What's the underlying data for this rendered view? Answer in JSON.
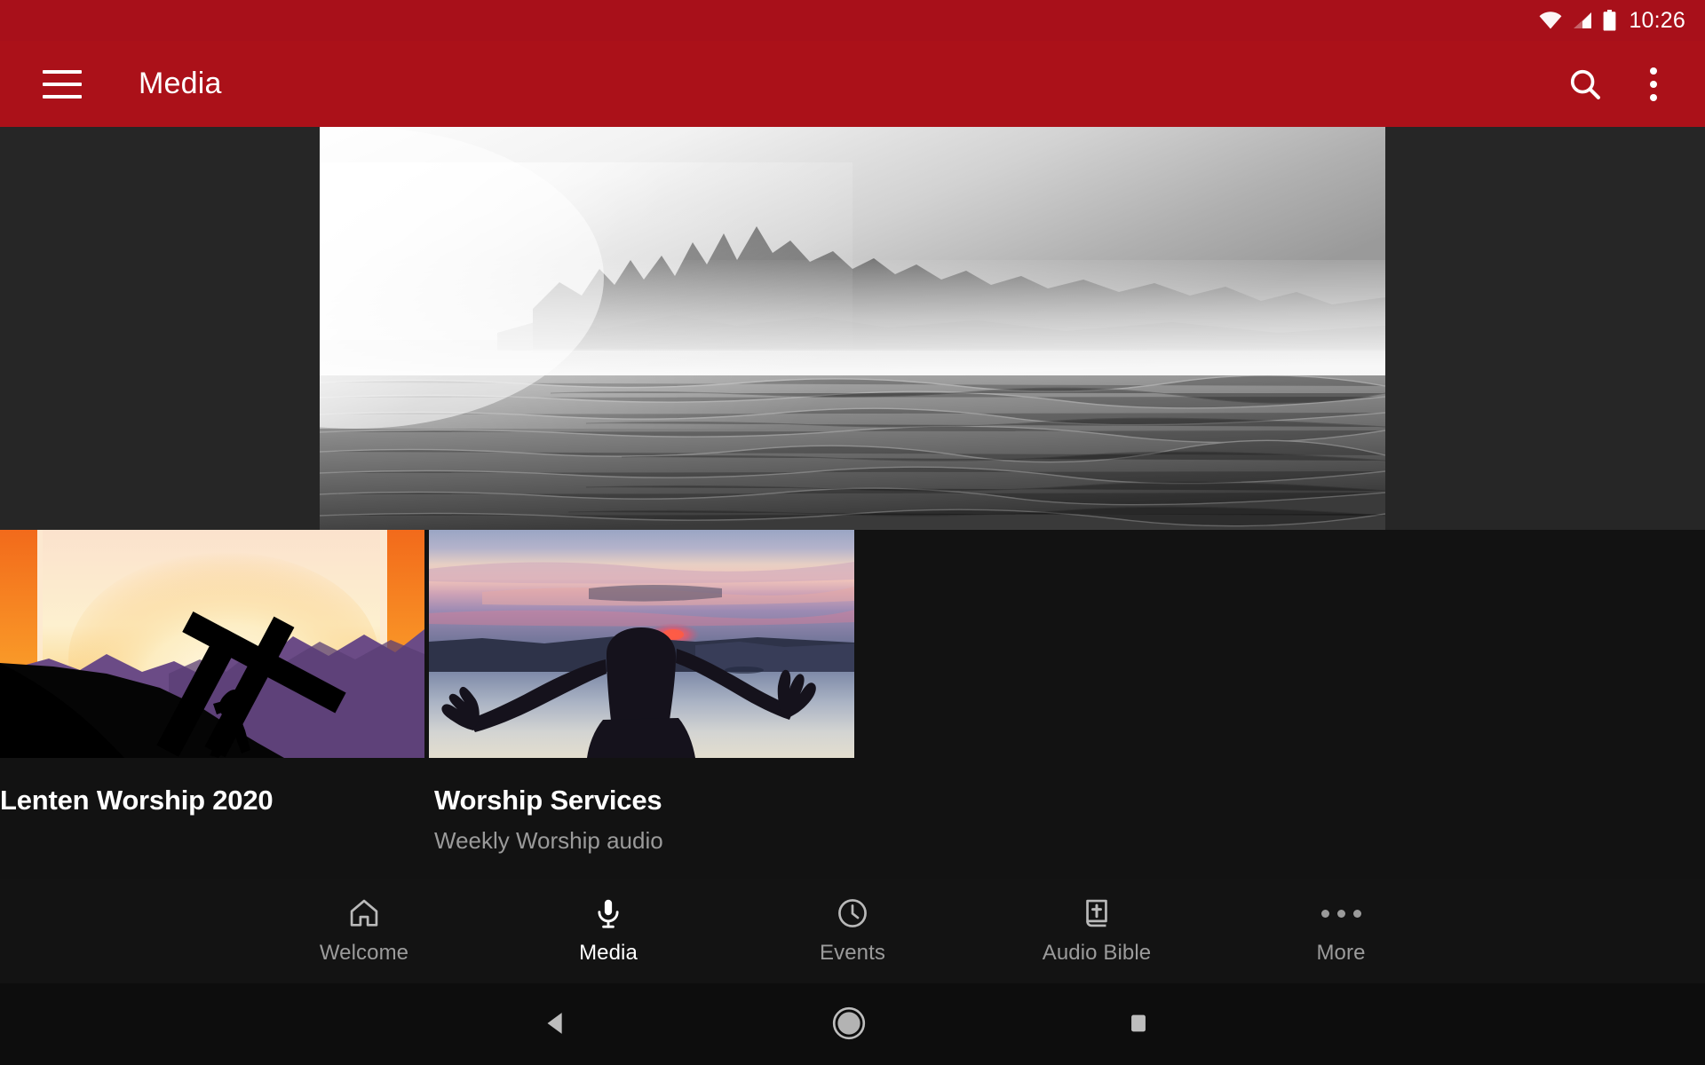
{
  "status_bar": {
    "time": "10:26",
    "icons": [
      "wifi-icon",
      "cellular-signal-icon",
      "battery-icon"
    ],
    "background_color": "#A8101A"
  },
  "app_bar": {
    "title": "Media",
    "menu_icon": "hamburger-menu-icon",
    "search_icon": "search-icon",
    "overflow_icon": "overflow-menu-icon",
    "background_color": "#AB1119",
    "text_color": "#FFFFFF"
  },
  "hero": {
    "alt": "Black and white misty mountains over a lake",
    "background_color": "#262626"
  },
  "media_cards": [
    {
      "title": "Lenten Worship 2020",
      "subtitle": "",
      "thumbnail": "silhouette-carrying-cross-at-sunset"
    },
    {
      "title": "Worship Services",
      "subtitle": "Weekly Worship audio",
      "thumbnail": "person-arms-raised-at-sunset-over-water"
    }
  ],
  "bottom_nav": {
    "active_index": 1,
    "items": [
      {
        "label": "Welcome",
        "icon": "home-icon",
        "active": false
      },
      {
        "label": "Media",
        "icon": "microphone-icon",
        "active": true
      },
      {
        "label": "Events",
        "icon": "clock-icon",
        "active": false
      },
      {
        "label": "Audio Bible",
        "icon": "bible-book-icon",
        "active": false
      },
      {
        "label": "More",
        "icon": "more-dots-icon",
        "active": false
      }
    ],
    "active_color": "#FFFFFF",
    "inactive_color": "#9B9B9B",
    "background_color": "#131313"
  },
  "system_nav": {
    "back": "back-triangle-icon",
    "home": "home-circle-icon",
    "recents": "recents-square-icon",
    "background_color": "#0D0D0D"
  },
  "page_background": "#121212"
}
